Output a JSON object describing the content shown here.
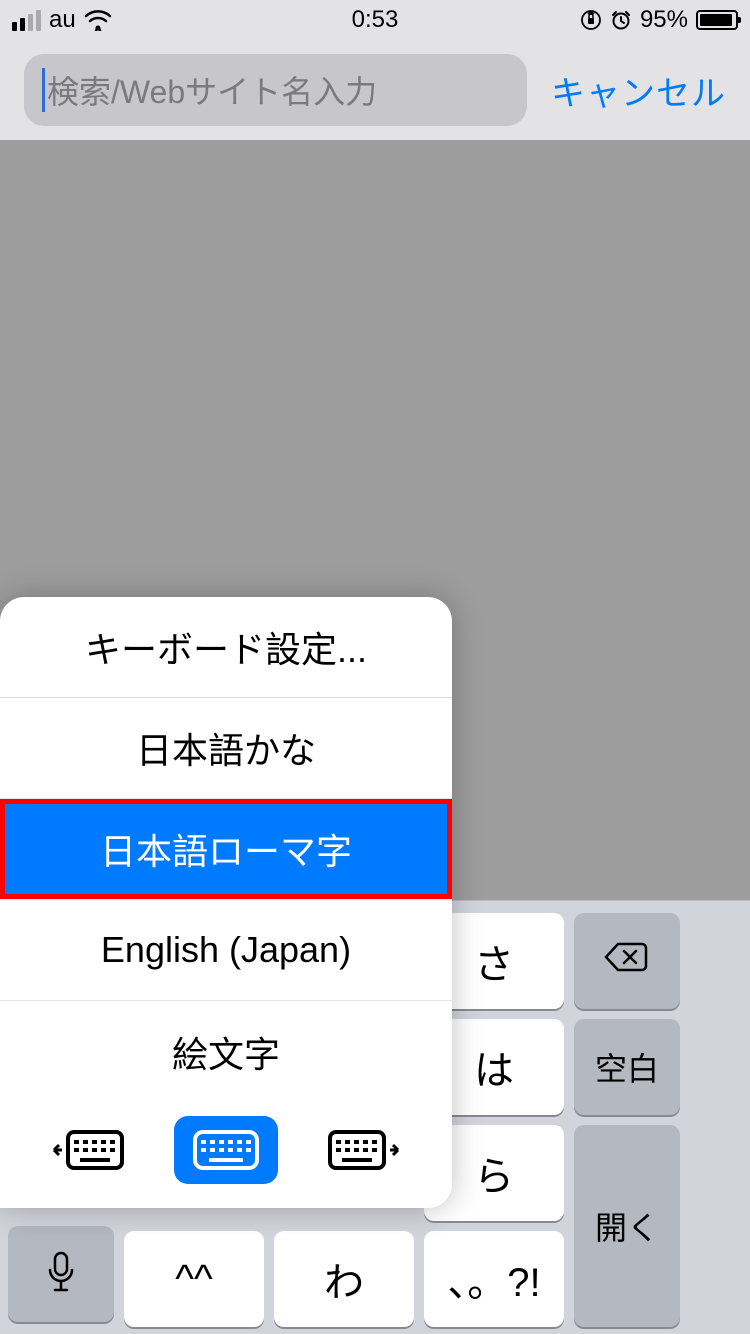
{
  "status": {
    "carrier": "au",
    "time": "0:53",
    "battery_pct": "95%"
  },
  "search": {
    "placeholder": "検索/Webサイト名入力",
    "value": "",
    "cancel": "キャンセル"
  },
  "popup": {
    "settings": "キーボード設定...",
    "items": [
      {
        "label": "日本語かな",
        "selected": false,
        "highlighted": false
      },
      {
        "label": "日本語ローマ字",
        "selected": true,
        "highlighted": true
      },
      {
        "label": "English (Japan)",
        "selected": false,
        "highlighted": false
      },
      {
        "label": "絵文字",
        "selected": false,
        "highlighted": false
      }
    ]
  },
  "keyboard": {
    "keys": {
      "sa": "さ",
      "ha": "は",
      "ra": "ら",
      "wa": "わ",
      "punct": "、。?!",
      "face": "^^",
      "space": "空白",
      "open": "開く"
    }
  }
}
